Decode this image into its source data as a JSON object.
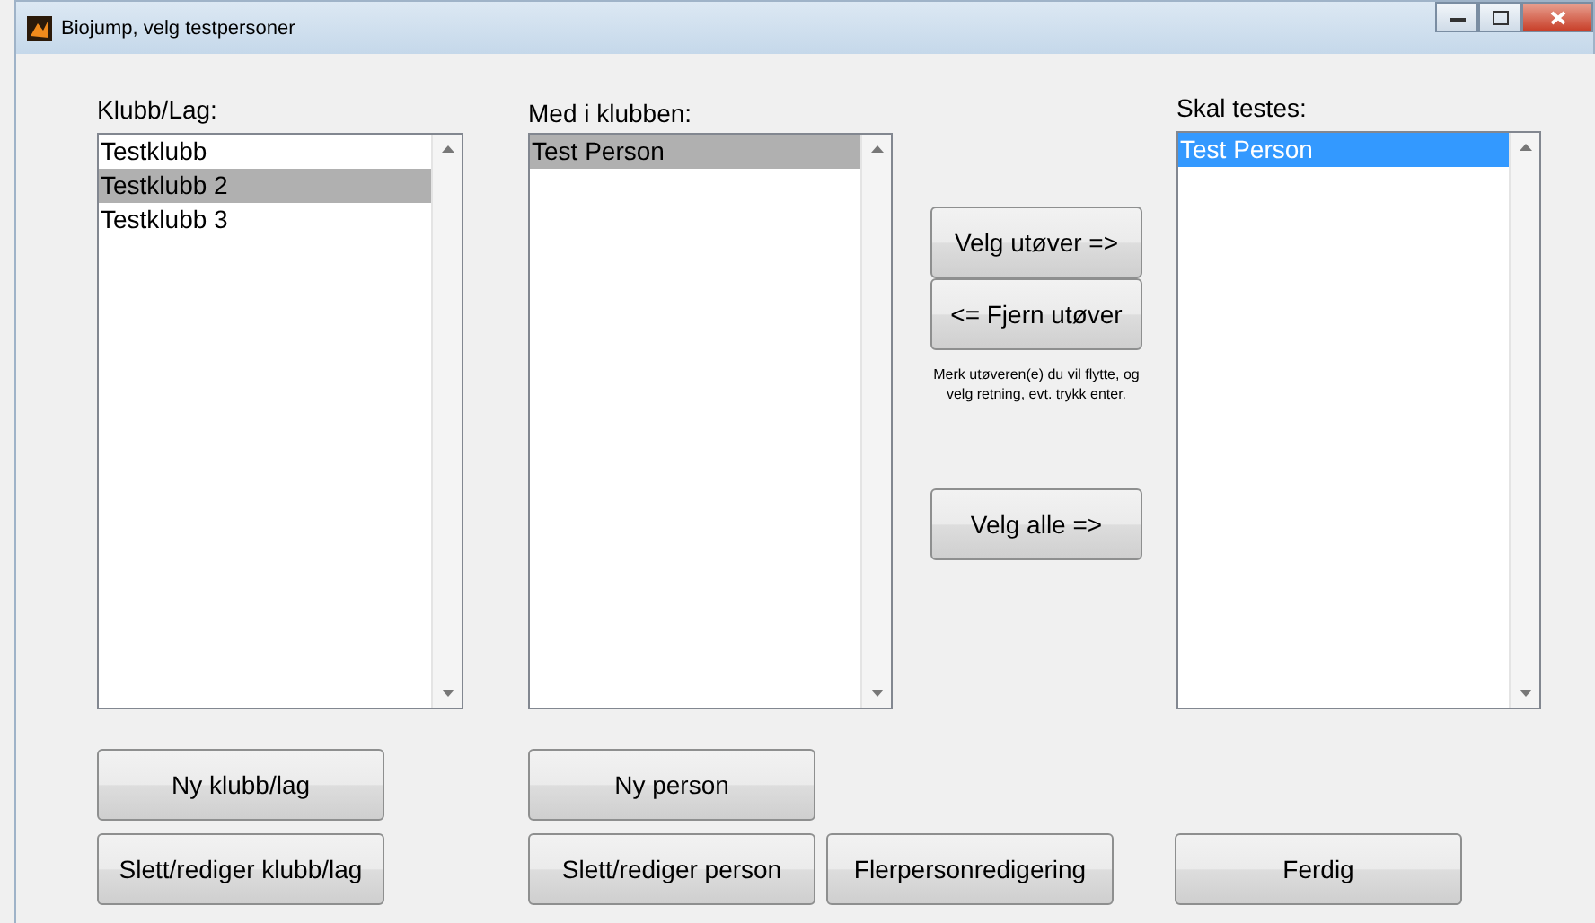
{
  "window": {
    "title": "Biojump, velg testpersoner"
  },
  "lists": [
    {
      "label": "Klubb/Lag:",
      "focused": false,
      "items": [
        {
          "text": "Testklubb",
          "selected": false
        },
        {
          "text": "Testklubb 2",
          "selected": true
        },
        {
          "text": "Testklubb 3",
          "selected": false
        }
      ]
    },
    {
      "label": "Med i klubben:",
      "focused": false,
      "items": [
        {
          "text": "Test Person",
          "selected": true
        }
      ]
    },
    {
      "label": "Skal testes:",
      "focused": true,
      "items": [
        {
          "text": "Test Person",
          "selected": true
        }
      ]
    }
  ],
  "move_buttons": [
    "Velg utøver =>",
    "<= Fjern utøver"
  ],
  "hint": "Merk utøveren(e) du vil flytte, og velg retning, evt. trykk enter.",
  "select_all_button": "Velg alle =>",
  "bottom_buttons": {
    "club": [
      "Ny klubb/lag",
      "Slett/rediger klubb/lag"
    ],
    "person": [
      "Ny person",
      "Slett/rediger person"
    ],
    "multi": "Flerpersonredigering",
    "done": "Ferdig"
  }
}
